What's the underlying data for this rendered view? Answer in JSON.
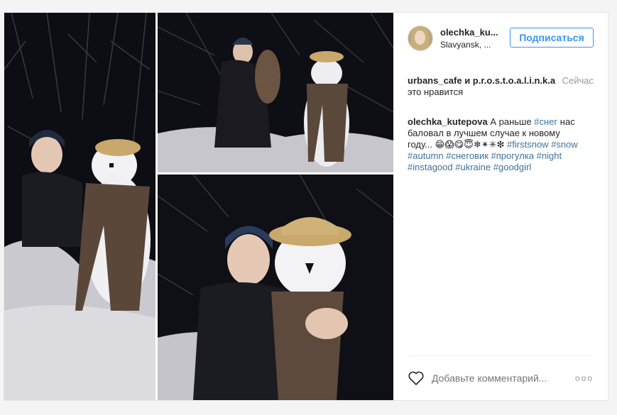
{
  "post": {
    "username": "olechka_ku...",
    "location": "Slavyansk, ...",
    "follow_label": "Подписаться",
    "likes": {
      "names": "urbans_cafe и p.r.o.s.t.o.a.l.i.n.k.a",
      "suffix": "это нравится",
      "time": "Сейчас"
    },
    "caption": {
      "author": "olechka_kutepova",
      "text_1": " А раньше ",
      "tag_snow": "#снег",
      "text_2": " нас баловал в лучшем случае к новому году... ",
      "emoji": "😁😱😋😇❄✴✳❇",
      "hashtags": [
        "#firstsnow",
        "#snow",
        "#autumn",
        "#снеговик",
        "#прогулка",
        "#night",
        "#instagood",
        "#ukraine",
        "#goodgirl"
      ]
    },
    "comment_placeholder": "Добавьте комментарий...",
    "more_label": "ooo"
  },
  "colors": {
    "accent": "#3897f0",
    "hashtag": "#3f729b",
    "muted": "#999999"
  }
}
